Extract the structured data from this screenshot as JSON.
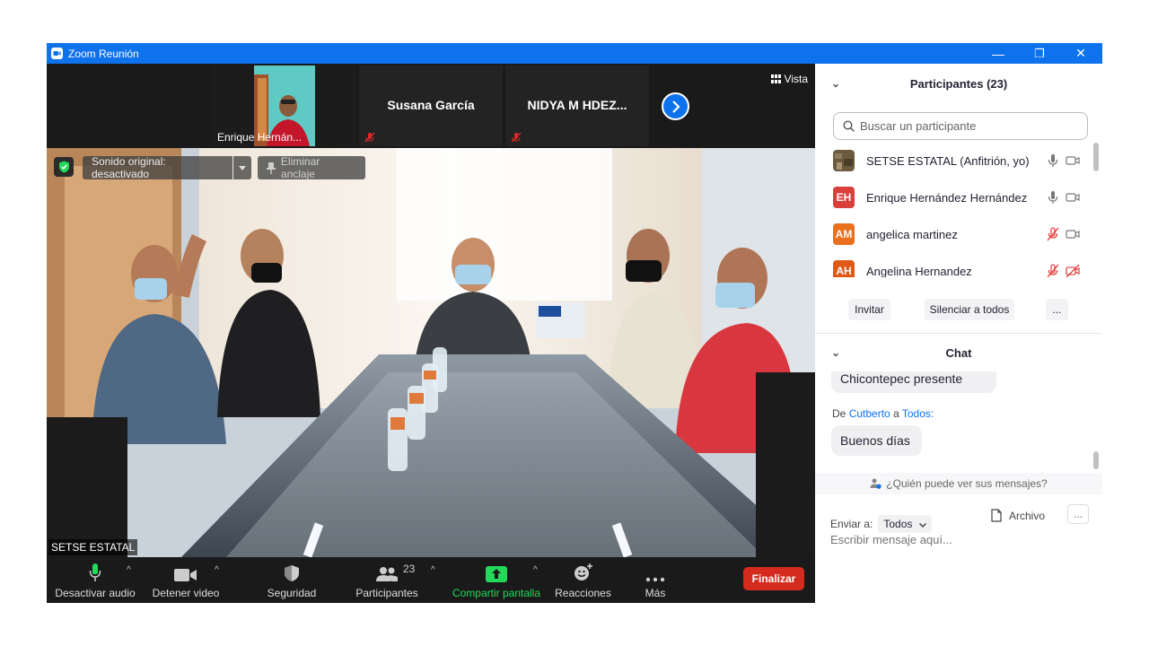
{
  "window": {
    "title": "Zoom Reunión",
    "minimize": "—",
    "restore": "❐",
    "close": "✕"
  },
  "colors": {
    "accent": "#0e72ed",
    "end": "#d52b1e",
    "share": "#23d959"
  },
  "video_strip": {
    "tiles": [
      {
        "name": "Enrique Hernán..."
      },
      {
        "name": "Susana García"
      },
      {
        "name": "NIDYA  M  HDEZ..."
      }
    ],
    "view_label": "Vista"
  },
  "main_video": {
    "sound_pill": "Sonido original: desactivado",
    "unpin_label": "Eliminar anclaje",
    "speaker_name": "SETSE ESTATAL"
  },
  "toolbar": {
    "mute_label": "Desactivar audio",
    "video_label": "Detener video",
    "security_label": "Seguridad",
    "participants_label": "Participantes",
    "participants_count": "23",
    "share_label": "Compartir pantalla",
    "reactions_label": "Reacciones",
    "more_label": "Más",
    "end_label": "Finalizar"
  },
  "participants_panel": {
    "title": "Participantes (23)",
    "search_placeholder": "Buscar un participante",
    "items": [
      {
        "initials": "",
        "name": "SETSE ESTATAL (Anfitrión, yo)",
        "color": "#6b5a3e",
        "audio": "on",
        "video": "on"
      },
      {
        "initials": "EH",
        "name": "Enrique Hernández Hernández",
        "color": "#d9403b",
        "audio": "on",
        "video": "on"
      },
      {
        "initials": "AM",
        "name": "angelica martinez",
        "color": "#e9701e",
        "audio": "muted",
        "video": "on"
      },
      {
        "initials": "AH",
        "name": "Angelina Hernandez",
        "color": "#e05a16",
        "audio": "muted",
        "video": "off"
      }
    ],
    "invite_label": "Invitar",
    "mute_all_label": "Silenciar a todos",
    "more_label": "..."
  },
  "chat_panel": {
    "title": "Chat",
    "messages": [
      {
        "text": "Chicontepec presente"
      },
      {
        "prefix": "De",
        "sender": "Cutberto",
        "connector": "a",
        "recipient": "Todos:",
        "text": "Buenos días"
      }
    ],
    "who_can_see": "¿Quién puede ver sus mensajes?",
    "send_to_label": "Enviar a:",
    "send_to_value": "Todos",
    "file_label": "Archivo",
    "more_label": "...",
    "input_placeholder": "Escribir mensaje aquí..."
  }
}
